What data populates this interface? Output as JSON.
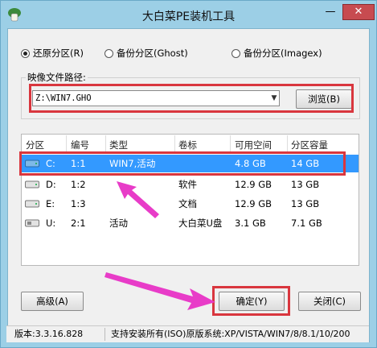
{
  "window": {
    "title": "大白菜PE装机工具",
    "minimize_glyph": "—",
    "close_glyph": "✕"
  },
  "mode": {
    "options": [
      {
        "label": "还原分区(R)",
        "selected": true
      },
      {
        "label": "备份分区(Ghost)",
        "selected": false
      },
      {
        "label": "备份分区(Imagex)",
        "selected": false
      }
    ]
  },
  "image_path": {
    "label": "映像文件路径:",
    "value": "Z:\\WIN7.GHO",
    "browse_label": "浏览(B)"
  },
  "table": {
    "columns": [
      "分区",
      "编号",
      "类型",
      "卷标",
      "可用空间",
      "分区容量"
    ],
    "rows": [
      {
        "part": "C:",
        "num": "1:1",
        "type": "WIN7,活动",
        "label": "",
        "free": "4.8 GB",
        "size": "14 GB",
        "selected": true
      },
      {
        "part": "D:",
        "num": "1:2",
        "type": "",
        "label": "软件",
        "free": "12.9 GB",
        "size": "13 GB",
        "selected": false
      },
      {
        "part": "E:",
        "num": "1:3",
        "type": "",
        "label": "文档",
        "free": "12.9 GB",
        "size": "13 GB",
        "selected": false
      },
      {
        "part": "U:",
        "num": "2:1",
        "type": "活动",
        "label": "大白菜U盘",
        "free": "3.1 GB",
        "size": "7.1 GB",
        "selected": false
      }
    ]
  },
  "buttons": {
    "advanced": "高级(A)",
    "ok": "确定(Y)",
    "close": "关闭(C)"
  },
  "status": {
    "version": "版本:3.3.16.828",
    "systems": "支持安装所有(ISO)原版系统:XP/VISTA/WIN7/8/8.1/10/200"
  },
  "colors": {
    "frame": "#9ccfe6",
    "highlight": "#d9363e",
    "arrow": "#e83cc8",
    "selection": "#3399ff"
  }
}
